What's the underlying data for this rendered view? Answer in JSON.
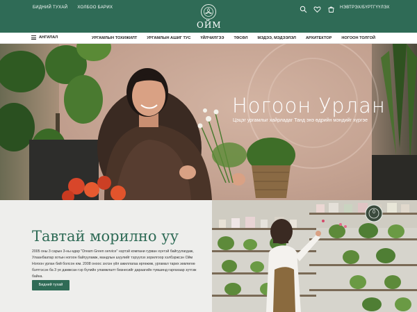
{
  "topbar": {
    "links": [
      "БИДНИЙ ТУХАЙ",
      "ХОЛБОО БАРИХ"
    ],
    "brand": "ОЙМ",
    "login": "НЭВТРЭХ/БҮРТГҮҮЛЭХ",
    "icons": [
      "search-icon",
      "heart-icon",
      "cart-icon"
    ]
  },
  "navbar": {
    "categories": "АНГИЛАЛ",
    "items": [
      "УРГАМЛЫН ТОХИЖИЛТ",
      "УРГАМЛЫН АШИГ ТУС",
      "ҮЙЛЧИЛГЭЭ",
      "ТӨСӨЛ",
      "МЭДЭЭ, МЭДЭЭЛЭЛ",
      "АРХИТЕКТОР",
      "НОГООН ТОЛГОЙ"
    ]
  },
  "hero": {
    "title": "Ногоон Урлан",
    "subtitle": "Цэцэг ургамлыг хайрладаг Танд энэ өдрийн мэндийг хүргэе"
  },
  "welcome": {
    "title": "Тавтай морилно уу",
    "body": "2005 оны 3 сарын 3-ны өдөр \"Dream Green service\" нэртэй компани гурван хүнтэй байгуулагдаж, Улаанбаатар хотын ногоон байгууламж, мандлын шүүлийг тэрүүлэх зорилгоор хэлбэржсэн Ойм Ногоон урлан бий болсон юм. 2008 оноос эхлэн үйл ажиллагаа өргөжиж, ургамал тарих зөвлөгөө бэлтгэсэн ба 3 үе дамжсан гэр бүлийн уламжлалт бизнесийг дараагийн түвшинд гаргахаар зүтгэж байна.",
    "button": "Бидний тухай"
  }
}
